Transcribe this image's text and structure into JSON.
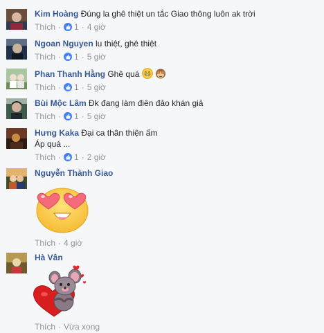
{
  "comments": [
    {
      "author": "Kim Hoàng",
      "text": "Đúng la ghê thiệt un tắc Giao thông luôn ak trời",
      "like_label": "Thích",
      "like_count": "1",
      "time": "4 giờ",
      "avatar_colors": [
        "#6b4f3a",
        "#d8b6a0",
        "#2e3b4e"
      ]
    },
    {
      "author": "Ngoan Nguyen",
      "text": "lu thiệt, ghê thiệt",
      "like_label": "Thích",
      "like_count": "1",
      "time": "5 giờ",
      "avatar_colors": [
        "#20304a",
        "#c7b39a",
        "#5f6f82"
      ]
    },
    {
      "author": "Phan Thanh Hằng",
      "text": "Ghê quá",
      "like_label": "Thích",
      "like_count": "1",
      "time": "5 giờ",
      "avatar_colors": [
        "#a9c6a0",
        "#f0ddd0",
        "#6f8f5a"
      ]
    },
    {
      "author": "Bùi Mộc Lâm",
      "text": "Đk đang làm điên đảo khán giả",
      "like_label": "Thích",
      "like_count": "1",
      "time": "5 giờ",
      "avatar_colors": [
        "#1f2a2f",
        "#3d5a4a",
        "#9fb0a6"
      ]
    },
    {
      "author": "Hưng Kaka",
      "text": "Đại ca thân thiện ấm",
      "text2": "Áp quá ...",
      "like_label": "Thích",
      "like_count": "1",
      "time": "2 giờ",
      "avatar_colors": [
        "#6a3b22",
        "#c98a44",
        "#2d1b12"
      ]
    },
    {
      "author": "Nguyễn Thành Giao",
      "like_label": "Thích",
      "time": "4 giờ",
      "avatar_colors": [
        "#e2b36a",
        "#c05a2e",
        "#3b4f2a"
      ]
    },
    {
      "author": "Hà Vân",
      "like_label": "Thích",
      "time": "Vừa xong",
      "avatar_colors": [
        "#b59a52",
        "#e9d6a8",
        "#6f5a2e"
      ]
    }
  ],
  "colors": {
    "author": "#365899",
    "meta": "#90949c",
    "like_badge": "#4080ff",
    "background": "#f6f7f9"
  }
}
